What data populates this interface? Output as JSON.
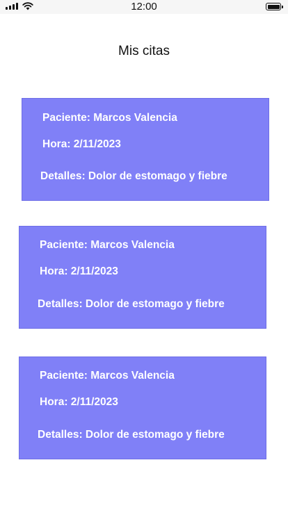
{
  "status_bar": {
    "time": "12:00",
    "icons": [
      "signal-icon",
      "wifi-icon",
      "battery-icon"
    ]
  },
  "page": {
    "title": "Mis citas"
  },
  "appointments": [
    {
      "patient": "Paciente: Marcos Valencia",
      "time": "Hora: 2/11/2023",
      "details": "Detalles: Dolor de estomago y fiebre"
    },
    {
      "patient": "Paciente: Marcos Valencia",
      "time": "Hora: 2/11/2023",
      "details": "Detalles: Dolor de estomago y fiebre"
    },
    {
      "patient": "Paciente: Marcos Valencia",
      "time": "Hora: 2/11/2023",
      "details": "Detalles: Dolor de estomago y fiebre"
    }
  ],
  "colors": {
    "card_background": "#8080f7",
    "card_text": "#ffffff",
    "title_text": "#111111"
  }
}
